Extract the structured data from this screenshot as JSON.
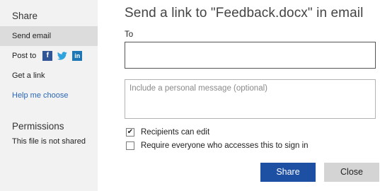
{
  "sidebar": {
    "heading": "Share",
    "items": {
      "send_email": "Send email",
      "post_to": "Post to",
      "get_link": "Get a link",
      "help": "Help me choose"
    },
    "social_icons": [
      "facebook-icon",
      "twitter-icon",
      "linkedin-icon"
    ],
    "permissions_heading": "Permissions",
    "permissions_note": "This file is not shared"
  },
  "main": {
    "title": "Send a link to \"Feedback.docx\" in email",
    "to_label": "To",
    "to_value": "",
    "message_placeholder": "Include a personal message (optional)",
    "options": [
      {
        "label": "Recipients can edit",
        "checked": true
      },
      {
        "label": "Require everyone who accesses this to sign in",
        "checked": false
      }
    ],
    "share_button": "Share",
    "close_button": "Close"
  },
  "colors": {
    "primary_button": "#1d4fa3",
    "link": "#2a66b7",
    "sidebar_bg": "#f2f2f2",
    "selected_bg": "#dcdcdc"
  }
}
